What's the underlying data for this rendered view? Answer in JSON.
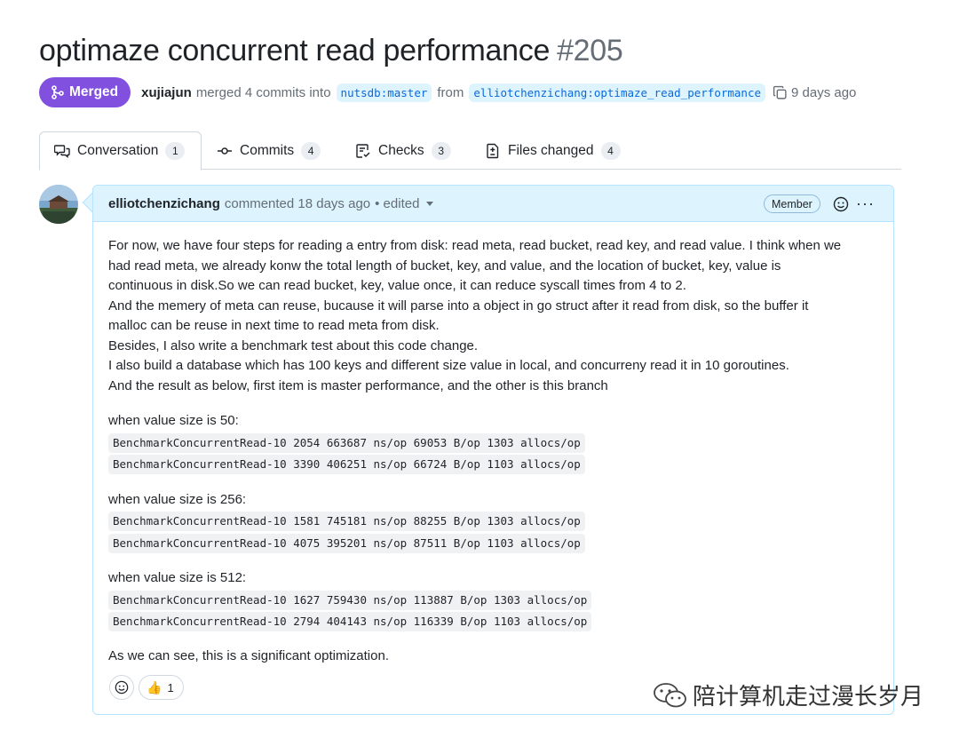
{
  "pr": {
    "title": "optimaze concurrent read performance",
    "number": "#205",
    "status": "Merged",
    "merger": "xujiajun",
    "merge_text": "merged 4 commits into",
    "base_branch": "nutsdb:master",
    "from_text": "from",
    "head_branch": "elliotchenzichang:optimaze_read_performance",
    "time_ago": "9 days ago"
  },
  "tabs": [
    {
      "label": "Conversation",
      "count": "1",
      "icon": "comment-discussion-icon",
      "active": true
    },
    {
      "label": "Commits",
      "count": "4",
      "icon": "git-commit-icon"
    },
    {
      "label": "Checks",
      "count": "3",
      "icon": "checklist-icon"
    },
    {
      "label": "Files changed",
      "count": "4",
      "icon": "file-diff-icon"
    }
  ],
  "comment": {
    "author": "elliotchenzichang",
    "action": "commented 18 days ago",
    "edited": "• edited",
    "role_badge": "Member",
    "paragraphs": [
      "For now, we have four steps for reading a entry from disk: read meta, read bucket, read key, and read value. I think when we",
      "had read meta, we already konw the total length of bucket, key, and value, and the location of bucket, key, value is",
      "continuous in disk.So we can read bucket, key, value once, it can reduce syscall times from 4 to 2.",
      "And the memery of meta can reuse, bucause it will parse into a object in go struct after it read from disk, so the buffer it",
      "malloc can be reuse in next time to read meta from disk.",
      "Besides, I also write a benchmark test about this code change.",
      "I also build a database which has 100 keys and different size value in local, and concurreny read it in 10 goroutines.",
      "And the result as below, first item is master performance, and the other is this branch"
    ],
    "cases": [
      {
        "label": "when value size is 50:",
        "lines": [
          "BenchmarkConcurrentRead-10 2054 663687 ns/op 69053 B/op 1303 allocs/op",
          "BenchmarkConcurrentRead-10 3390 406251 ns/op 66724 B/op 1103 allocs/op"
        ]
      },
      {
        "label": "when value size is 256:",
        "lines": [
          "BenchmarkConcurrentRead-10 1581 745181 ns/op 88255 B/op 1303 allocs/op",
          "BenchmarkConcurrentRead-10 4075 395201 ns/op 87511 B/op 1103 allocs/op"
        ]
      },
      {
        "label": "when value size is 512:",
        "lines": [
          "BenchmarkConcurrentRead-10 1627 759430 ns/op 113887 B/op 1303 allocs/op",
          "BenchmarkConcurrentRead-10 2794 404143 ns/op 116339 B/op 1103 allocs/op"
        ]
      }
    ],
    "conclusion": "As we can see, this is a significant optimization.",
    "reactions": [
      {
        "emoji": "👍",
        "count": "1"
      }
    ]
  },
  "watermark": "陪计算机走过漫长岁月",
  "colors": {
    "merged": "#8250df",
    "link": "#0969da",
    "header_bg": "#ddf4ff"
  }
}
